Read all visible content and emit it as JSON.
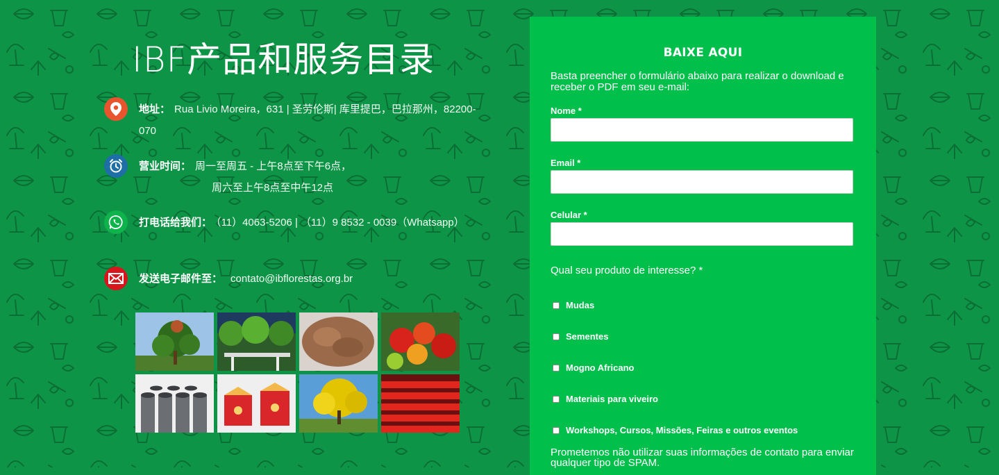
{
  "page_title": "IBF产品和服务目录",
  "contacts": [
    {
      "icon": "location-pin-icon",
      "color": "#e8542d",
      "label": "地址：",
      "value": "Rua Livio Moreira，631 | 圣劳伦斯| 库里提巴，巴拉那州，82200-070"
    },
    {
      "icon": "alarm-clock-icon",
      "color": "#1d6fa5",
      "label": "营业时间：",
      "value": "周一至周五 - 上午8点至下午6点，",
      "value2": "周六至上午8点至中午12点"
    },
    {
      "icon": "whatsapp-icon",
      "color": "#0fb34c",
      "label": "打电话给我们：",
      "value": "（11）4063-5206 | （11）9 8532 - 0039（Whatsapp）"
    },
    {
      "icon": "envelope-icon",
      "color": "#d7151d",
      "label": "发送电子邮件至：",
      "value": "contato@ibflorestas.org.br"
    }
  ],
  "photos": [
    {
      "name": "tree-photo"
    },
    {
      "name": "nursery-photo"
    },
    {
      "name": "seeds-photo"
    },
    {
      "name": "fruit-photo"
    },
    {
      "name": "tubes-photo"
    },
    {
      "name": "boxes-photo"
    },
    {
      "name": "yellow-tree-photo"
    },
    {
      "name": "red-trays-photo"
    }
  ],
  "form": {
    "title": "BAIXE AQUI",
    "intro": "Basta preencher o formulário abaixo para realizar o download e receber o PDF em seu e-mail:",
    "fields": [
      {
        "label": "Nome *",
        "value": ""
      },
      {
        "label": "Email *",
        "value": ""
      },
      {
        "label": "Celular *",
        "value": ""
      }
    ],
    "question": "Qual seu produto de interesse? *",
    "options": [
      "Mudas",
      "Sementes",
      "Mogno Africano",
      "Materiais para viveiro",
      "Workshops, Cursos, Missões, Feiras e outros eventos"
    ],
    "promise": "Prometemos não utilizar suas informações de contato para enviar qualquer tipo de SPAM."
  }
}
